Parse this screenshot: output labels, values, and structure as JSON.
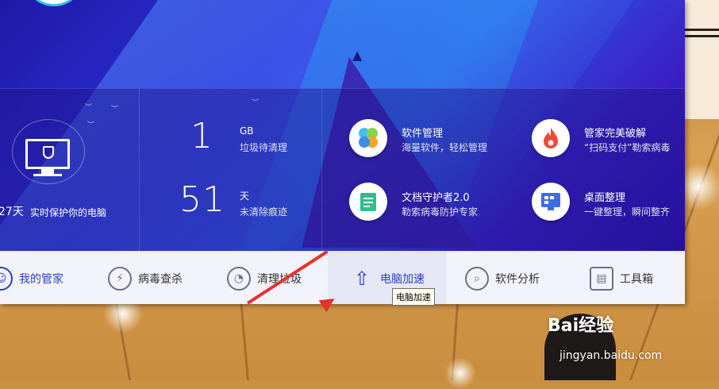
{
  "background": {
    "floor_color": "#c8913f"
  },
  "status": {
    "protect_days": "27天",
    "protect_text": "实时保护你的电脑"
  },
  "stats": [
    {
      "value": "1",
      "unit": "GB",
      "desc": "垃圾待清理"
    },
    {
      "value": "51",
      "unit": "天",
      "desc": "未清除痕迹"
    }
  ],
  "tiles": [
    {
      "title": "软件管理",
      "sub": "海量软件，轻松管理",
      "icon": "pinwheel-icon"
    },
    {
      "title": "管家完美破解",
      "sub": "“扫码支付”勒索病毒",
      "icon": "flame-icon"
    },
    {
      "title": "文档守护者2.0",
      "sub": "勒索病毒防护专家",
      "icon": "document-icon"
    },
    {
      "title": "桌面整理",
      "sub": "一键整理，瞬间整齐",
      "icon": "desktop-icon"
    }
  ],
  "nav": [
    {
      "label": "我的管家",
      "icon": "butler-icon"
    },
    {
      "label": "病毒查杀",
      "icon": "lightning-shield-icon"
    },
    {
      "label": "清理垃圾",
      "icon": "vacuum-icon"
    },
    {
      "label": "电脑加速",
      "icon": "rocket-icon"
    },
    {
      "label": "软件分析",
      "icon": "magnifier-chart-icon"
    },
    {
      "label": "工具箱",
      "icon": "toolbox-icon"
    }
  ],
  "tooltip": "电脑加速",
  "watermark": {
    "brand": "Bai经验",
    "url": "jingyan.baidu.com"
  },
  "colors": {
    "accent": "#2a3ec8",
    "hero": "#2f2fd8",
    "arrow": "#e5322c"
  }
}
